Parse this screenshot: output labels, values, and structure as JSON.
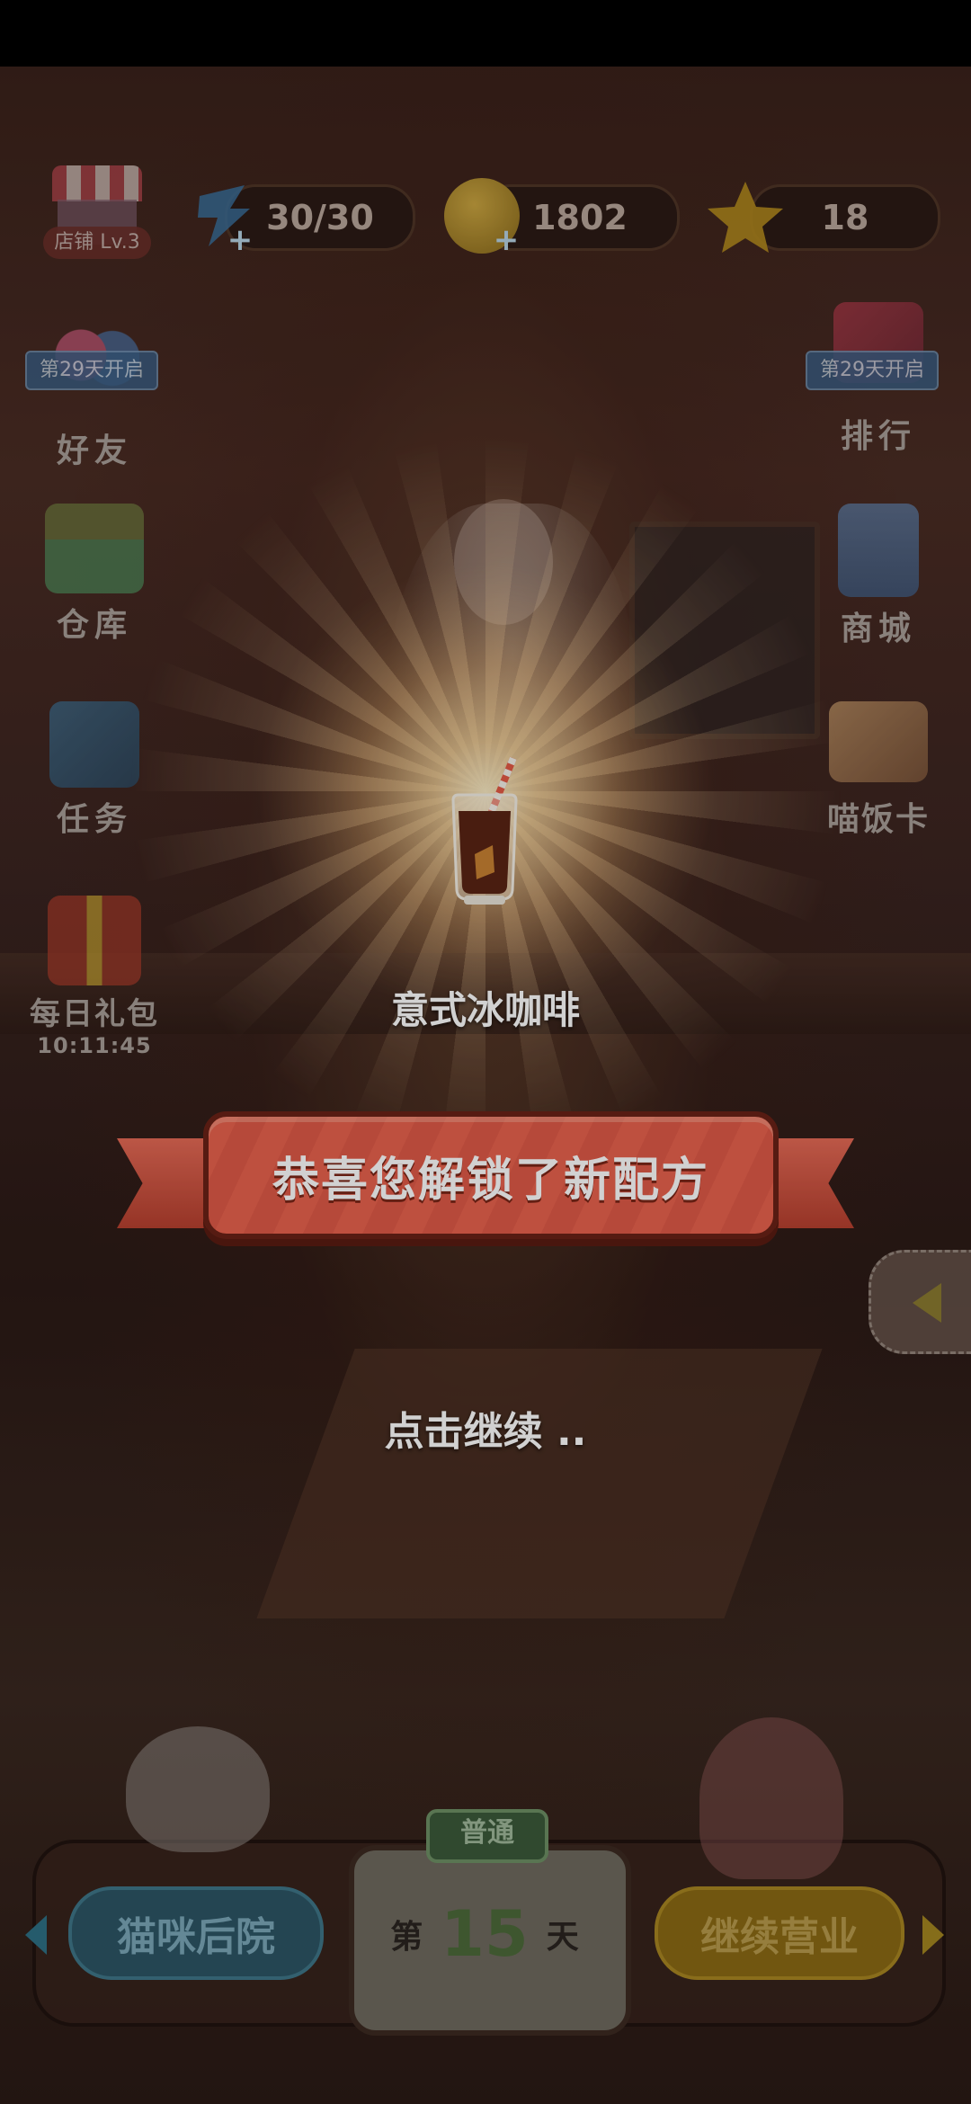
{
  "hud": {
    "shop_level": "店铺 Lv.3",
    "energy": "30/30",
    "coins": "1802",
    "stars": "18"
  },
  "side_left": {
    "friends_tag": "第29天开启",
    "friends": "好友",
    "warehouse": "仓库",
    "tasks": "任务",
    "daily_gift": "每日礼包",
    "daily_gift_timer": "10:11:45"
  },
  "side_right": {
    "ranking_tag": "第29天开启",
    "ranking": "排行",
    "mall": "商城",
    "meow_card": "喵饭卡"
  },
  "reward": {
    "item_name": "意式冰咖啡",
    "banner": "恭喜您解锁了新配方",
    "hint": "点击继续 .."
  },
  "bottom": {
    "backyard": "猫咪后院",
    "mode_tag": "普通",
    "day_prefix": "第",
    "day_number": "15",
    "day_suffix": "天",
    "continue": "继续营业"
  },
  "colors": {
    "banner": "#e8624e",
    "backyard_button": "#2c5564",
    "continue_button": "#8a6a14"
  }
}
